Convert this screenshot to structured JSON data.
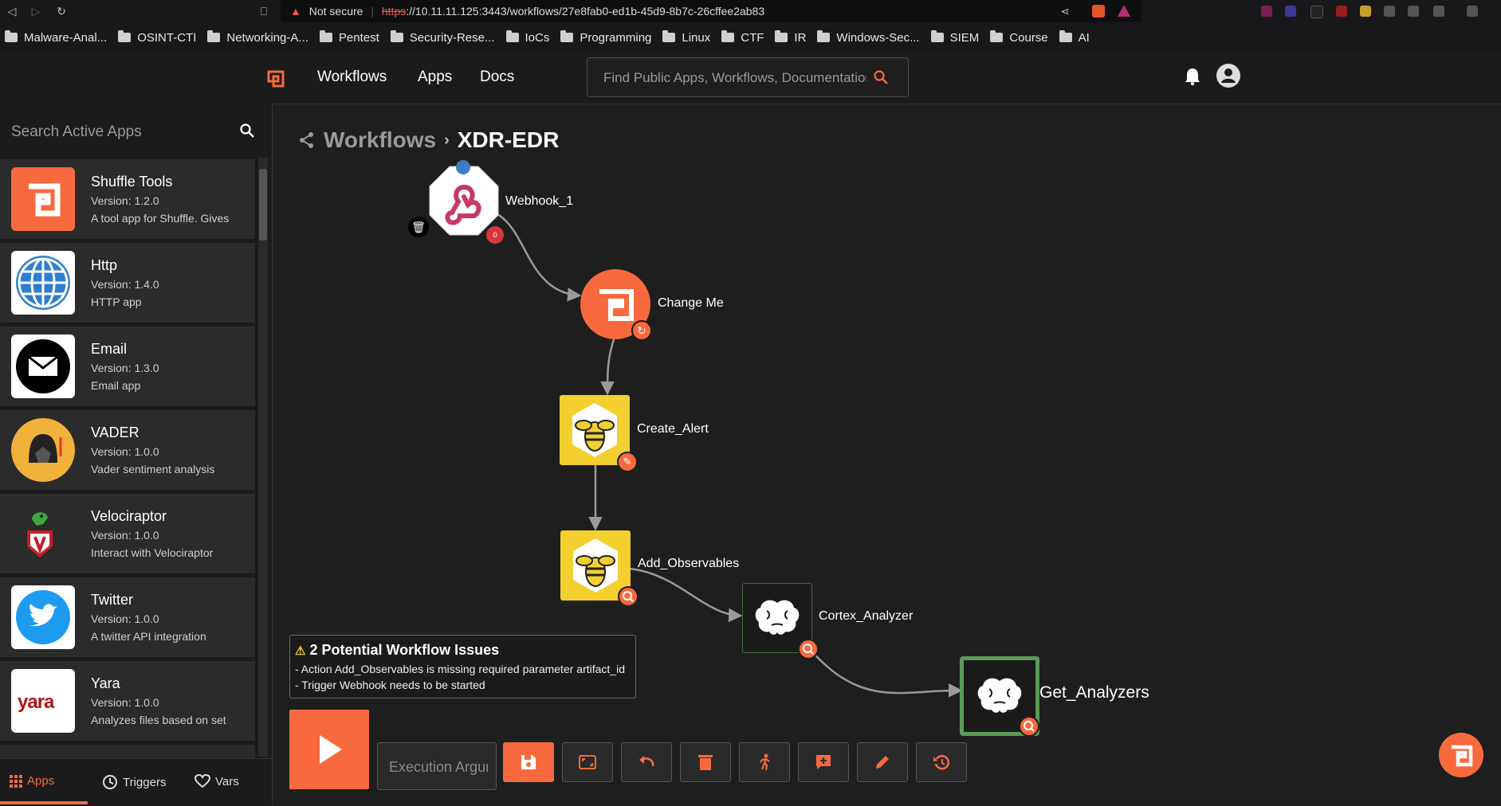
{
  "browser": {
    "security_label": "Not secure",
    "url_scheme": "https",
    "url_rest": "://10.11.11.125:3443/workflows/27e8fab0-ed1b-45d9-8b7c-26cffee2ab83",
    "bookmarks": [
      "Malware-Anal...",
      "OSINT-CTI",
      "Networking-A...",
      "Pentest",
      "Security-Rese...",
      "IoCs",
      "Programming",
      "Linux",
      "CTF",
      "IR",
      "Windows-Sec...",
      "SIEM",
      "Course",
      "AI"
    ]
  },
  "header": {
    "nav": [
      "Workflows",
      "Apps",
      "Docs"
    ],
    "search_placeholder": "Find Public Apps, Workflows, Documentation"
  },
  "sidebar": {
    "search_placeholder": "Search Active Apps",
    "apps": [
      {
        "name": "Shuffle Tools",
        "version": "Version: 1.2.0",
        "desc": "A tool app for Shuffle. Gives",
        "icon": "shuffle-tools-icon"
      },
      {
        "name": "Http",
        "version": "Version: 1.4.0",
        "desc": "HTTP app",
        "icon": "globe-icon"
      },
      {
        "name": "Email",
        "version": "Version: 1.3.0",
        "desc": "Email app",
        "icon": "envelope-icon"
      },
      {
        "name": "VADER",
        "version": "Version: 1.0.0",
        "desc": "Vader sentiment analysis",
        "icon": "vader-icon"
      },
      {
        "name": "Velociraptor",
        "version": "Version: 1.0.0",
        "desc": "Interact with Velociraptor",
        "icon": "velociraptor-icon"
      },
      {
        "name": "Twitter",
        "version": "Version: 1.0.0",
        "desc": "A twitter API integration",
        "icon": "twitter-bird-icon"
      },
      {
        "name": "Yara",
        "version": "Version: 1.0.0",
        "desc": "Analyzes files based on set",
        "icon": "yara-icon"
      }
    ],
    "yara_logo_text": "yara",
    "tabs": [
      "Apps",
      "Triggers",
      "Vars"
    ]
  },
  "workflow": {
    "breadcrumb_root": "Workflows",
    "breadcrumb_sep": "›",
    "name": "XDR-EDR",
    "nodes": {
      "webhook": "Webhook_1",
      "change_me": "Change Me",
      "create_alert": "Create_Alert",
      "add_observables": "Add_Observables",
      "cortex_analyzer": "Cortex_Analyzer",
      "get_analyzers": "Get_Analyzers"
    },
    "webhook_badge": "0"
  },
  "issues": {
    "title": "2 Potential Workflow Issues",
    "items": [
      "- Action Add_Observables is missing required parameter artifact_id",
      "- Trigger Webhook needs to be started"
    ]
  },
  "toolbar": {
    "exec_placeholder": "Execution Argument"
  },
  "colors": {
    "accent": "#f86a3e",
    "thehive_yellow": "#f3d02f",
    "selected_border": "#5a9a55"
  }
}
